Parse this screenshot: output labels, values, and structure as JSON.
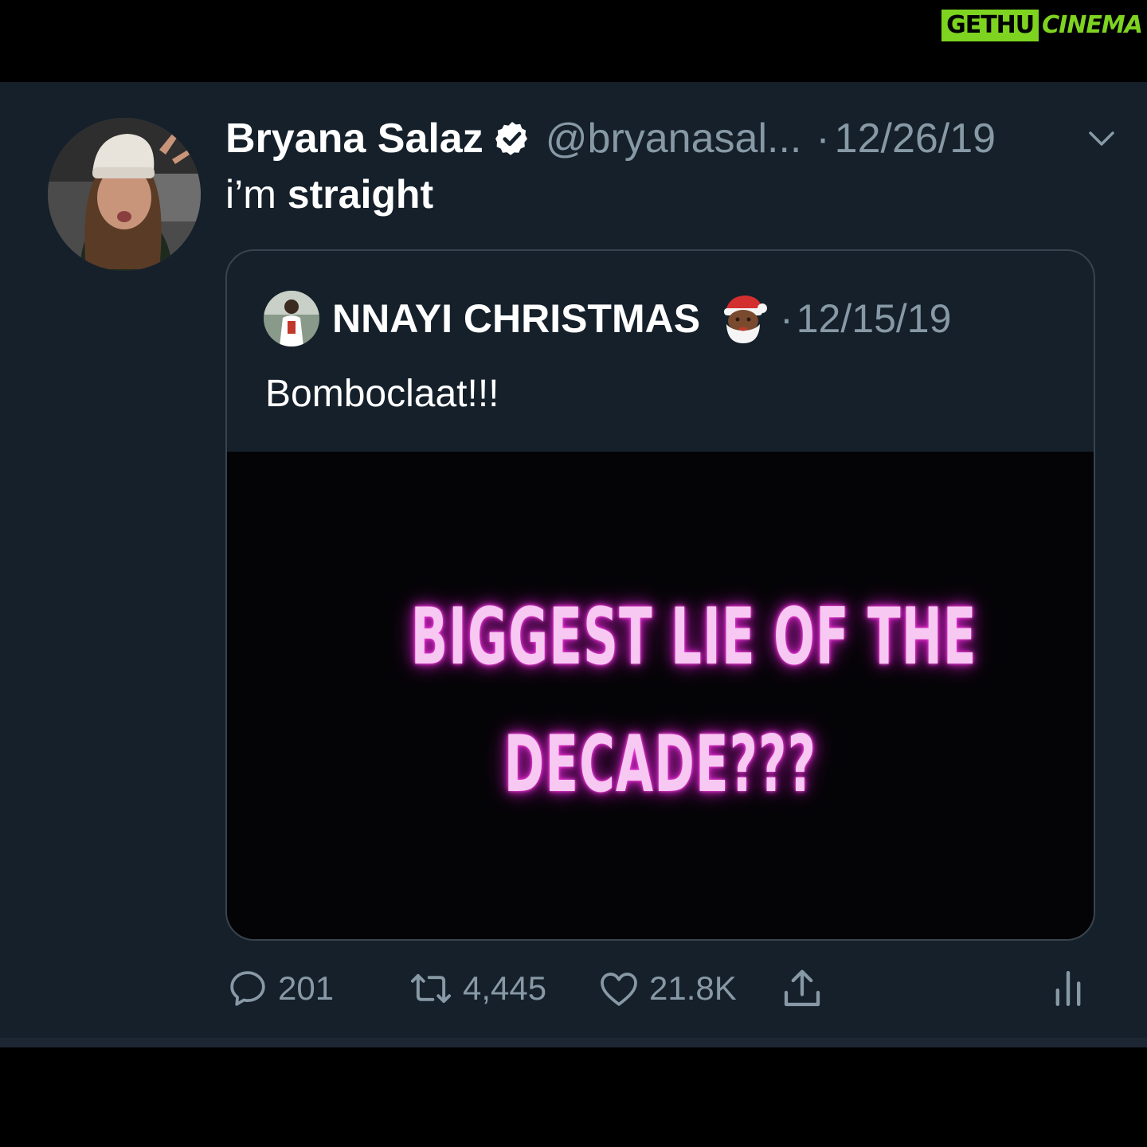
{
  "watermark": {
    "part1": "GETHU",
    "part2": "CINEMA"
  },
  "tweet": {
    "author_name": "Bryana Salaz",
    "handle": "@bryanasal...",
    "separator": "·",
    "date": "12/26/19",
    "text_prefix": "i’m ",
    "text_bold": "straight",
    "verified_icon": "verified-badge",
    "menu_icon": "chevron-down"
  },
  "quote": {
    "author_name": "NNAYI CHRISTMAS",
    "emoji": "santa",
    "separator": "·",
    "date": "12/15/19",
    "text": "Bomboclaat!!!",
    "media": {
      "line1": "BIGGEST LIE OF THE",
      "line2": "DECADE???",
      "glow_color": "#e02bd0"
    }
  },
  "actions": {
    "reply_count": "201",
    "retweet_count": "4,445",
    "like_count": "21.8K",
    "share_icon": "share",
    "analytics_icon": "analytics"
  },
  "colors": {
    "background": "#15202b",
    "border": "#38444d",
    "secondary_text": "#8899a6",
    "primary_text": "#ffffff",
    "watermark": "#7ed321"
  }
}
